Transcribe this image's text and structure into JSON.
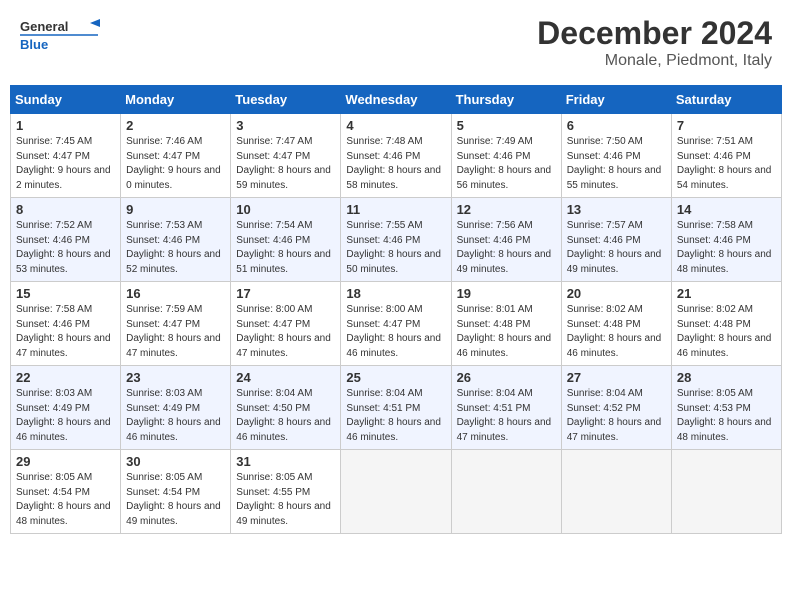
{
  "header": {
    "logo_general": "General",
    "logo_blue": "Blue",
    "title": "December 2024",
    "subtitle": "Monale, Piedmont, Italy"
  },
  "weekdays": [
    "Sunday",
    "Monday",
    "Tuesday",
    "Wednesday",
    "Thursday",
    "Friday",
    "Saturday"
  ],
  "weeks": [
    [
      {
        "day": "1",
        "rise": "7:45 AM",
        "set": "4:47 PM",
        "daylight": "9 hours and 2 minutes."
      },
      {
        "day": "2",
        "rise": "7:46 AM",
        "set": "4:47 PM",
        "daylight": "9 hours and 0 minutes."
      },
      {
        "day": "3",
        "rise": "7:47 AM",
        "set": "4:47 PM",
        "daylight": "8 hours and 59 minutes."
      },
      {
        "day": "4",
        "rise": "7:48 AM",
        "set": "4:46 PM",
        "daylight": "8 hours and 58 minutes."
      },
      {
        "day": "5",
        "rise": "7:49 AM",
        "set": "4:46 PM",
        "daylight": "8 hours and 56 minutes."
      },
      {
        "day": "6",
        "rise": "7:50 AM",
        "set": "4:46 PM",
        "daylight": "8 hours and 55 minutes."
      },
      {
        "day": "7",
        "rise": "7:51 AM",
        "set": "4:46 PM",
        "daylight": "8 hours and 54 minutes."
      }
    ],
    [
      {
        "day": "8",
        "rise": "7:52 AM",
        "set": "4:46 PM",
        "daylight": "8 hours and 53 minutes."
      },
      {
        "day": "9",
        "rise": "7:53 AM",
        "set": "4:46 PM",
        "daylight": "8 hours and 52 minutes."
      },
      {
        "day": "10",
        "rise": "7:54 AM",
        "set": "4:46 PM",
        "daylight": "8 hours and 51 minutes."
      },
      {
        "day": "11",
        "rise": "7:55 AM",
        "set": "4:46 PM",
        "daylight": "8 hours and 50 minutes."
      },
      {
        "day": "12",
        "rise": "7:56 AM",
        "set": "4:46 PM",
        "daylight": "8 hours and 49 minutes."
      },
      {
        "day": "13",
        "rise": "7:57 AM",
        "set": "4:46 PM",
        "daylight": "8 hours and 49 minutes."
      },
      {
        "day": "14",
        "rise": "7:58 AM",
        "set": "4:46 PM",
        "daylight": "8 hours and 48 minutes."
      }
    ],
    [
      {
        "day": "15",
        "rise": "7:58 AM",
        "set": "4:46 PM",
        "daylight": "8 hours and 47 minutes."
      },
      {
        "day": "16",
        "rise": "7:59 AM",
        "set": "4:47 PM",
        "daylight": "8 hours and 47 minutes."
      },
      {
        "day": "17",
        "rise": "8:00 AM",
        "set": "4:47 PM",
        "daylight": "8 hours and 47 minutes."
      },
      {
        "day": "18",
        "rise": "8:00 AM",
        "set": "4:47 PM",
        "daylight": "8 hours and 46 minutes."
      },
      {
        "day": "19",
        "rise": "8:01 AM",
        "set": "4:48 PM",
        "daylight": "8 hours and 46 minutes."
      },
      {
        "day": "20",
        "rise": "8:02 AM",
        "set": "4:48 PM",
        "daylight": "8 hours and 46 minutes."
      },
      {
        "day": "21",
        "rise": "8:02 AM",
        "set": "4:48 PM",
        "daylight": "8 hours and 46 minutes."
      }
    ],
    [
      {
        "day": "22",
        "rise": "8:03 AM",
        "set": "4:49 PM",
        "daylight": "8 hours and 46 minutes."
      },
      {
        "day": "23",
        "rise": "8:03 AM",
        "set": "4:49 PM",
        "daylight": "8 hours and 46 minutes."
      },
      {
        "day": "24",
        "rise": "8:04 AM",
        "set": "4:50 PM",
        "daylight": "8 hours and 46 minutes."
      },
      {
        "day": "25",
        "rise": "8:04 AM",
        "set": "4:51 PM",
        "daylight": "8 hours and 46 minutes."
      },
      {
        "day": "26",
        "rise": "8:04 AM",
        "set": "4:51 PM",
        "daylight": "8 hours and 47 minutes."
      },
      {
        "day": "27",
        "rise": "8:04 AM",
        "set": "4:52 PM",
        "daylight": "8 hours and 47 minutes."
      },
      {
        "day": "28",
        "rise": "8:05 AM",
        "set": "4:53 PM",
        "daylight": "8 hours and 48 minutes."
      }
    ],
    [
      {
        "day": "29",
        "rise": "8:05 AM",
        "set": "4:54 PM",
        "daylight": "8 hours and 48 minutes."
      },
      {
        "day": "30",
        "rise": "8:05 AM",
        "set": "4:54 PM",
        "daylight": "8 hours and 49 minutes."
      },
      {
        "day": "31",
        "rise": "8:05 AM",
        "set": "4:55 PM",
        "daylight": "8 hours and 49 minutes."
      },
      null,
      null,
      null,
      null
    ]
  ],
  "labels": {
    "sunrise": "Sunrise:",
    "sunset": "Sunset:",
    "daylight": "Daylight:"
  }
}
